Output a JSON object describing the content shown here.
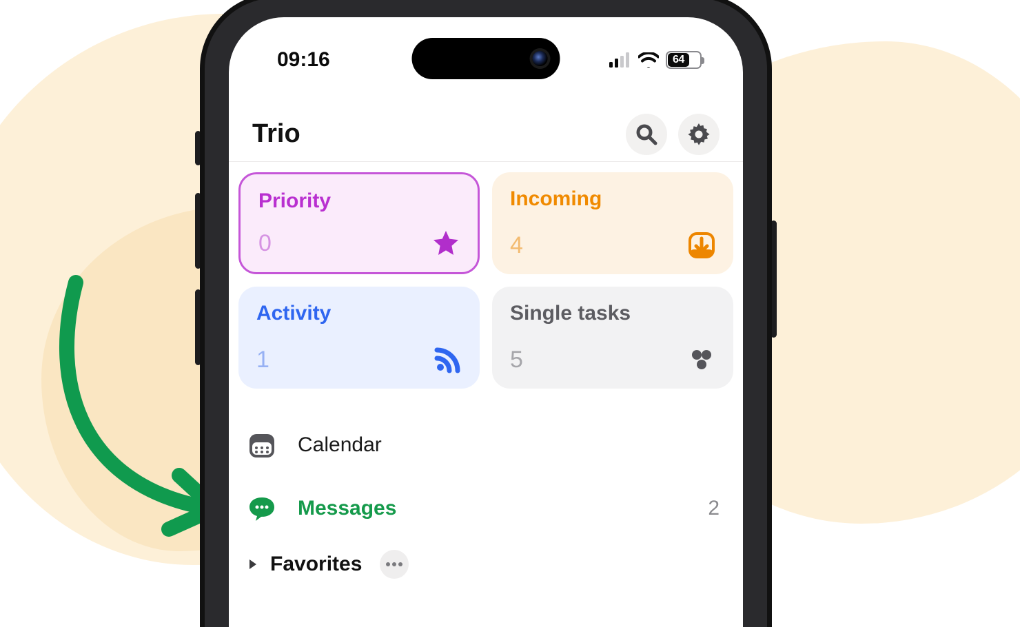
{
  "status_bar": {
    "time": "09:16",
    "battery_percent": "64"
  },
  "header": {
    "title": "Trio"
  },
  "cards": {
    "priority": {
      "label": "Priority",
      "count": "0"
    },
    "incoming": {
      "label": "Incoming",
      "count": "4"
    },
    "activity": {
      "label": "Activity",
      "count": "1"
    },
    "single_tasks": {
      "label": "Single tasks",
      "count": "5"
    }
  },
  "list": {
    "calendar_label": "Calendar",
    "messages_label": "Messages",
    "messages_count": "2",
    "favorites_label": "Favorites"
  },
  "colors": {
    "priority": "#b930d0",
    "incoming": "#f08a00",
    "activity": "#2f66f0",
    "single": "#5c5c61",
    "messages_green": "#159a4b"
  },
  "icons": {
    "search": "search-icon",
    "settings": "gear-icon",
    "star": "star-icon",
    "download": "download-icon",
    "rss": "rss-icon",
    "dots3": "three-dots-cluster-icon",
    "calendar": "calendar-icon",
    "chat": "chat-bubble-icon",
    "disclosure": "disclosure-triangle-icon",
    "more": "ellipsis-icon"
  }
}
